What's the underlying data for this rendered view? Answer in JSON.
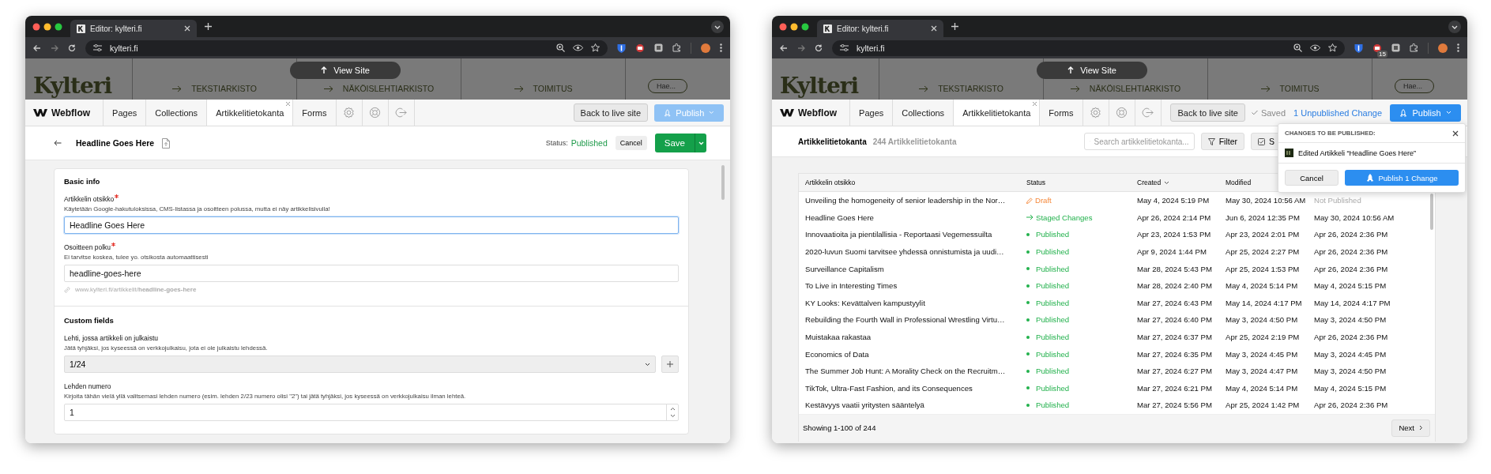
{
  "windows": [
    {
      "kind": "item_editor",
      "browser": {
        "tab_title": "Editor: kylteri.fi",
        "url": "kylteri.fi"
      },
      "site_header": {
        "logo": "Kylteri",
        "view_site": "View Site",
        "nav": [
          "TEKSTIARKISTO",
          "NÄKÖISLEHTIARKISTO",
          "TOIMITUS"
        ],
        "search_placeholder": "Hae..."
      },
      "toolbar": {
        "brand": "Webflow",
        "tabs": [
          {
            "label": "Pages",
            "selected": false
          },
          {
            "label": "Collections",
            "selected": false
          },
          {
            "label": "Artikkelitietokanta",
            "selected": true
          },
          {
            "label": "Forms",
            "selected": false
          }
        ],
        "back_button": "Back to live site",
        "publish": {
          "label": "Publish",
          "disabled": true
        }
      },
      "editor": {
        "title": "Headline Goes Here",
        "status_label": "Status:",
        "status": "Published",
        "cancel": "Cancel",
        "save": "Save",
        "sections": [
          {
            "title": "Basic info",
            "fields": [
              {
                "kind": "text",
                "label": "Artikkelin otsikko",
                "required": true,
                "help": "Käytetään Google-hakutuloksissa, CMS-listassa ja osoitteen polussa, mutta ei näy artikkelisivulla!",
                "value": "Headline Goes Here",
                "focused": true
              },
              {
                "kind": "text",
                "label": "Osoitteen polku",
                "required": true,
                "help": "Ei tarvitse koskea, tulee yo. otsikosta automaattisesti",
                "value": "headline-goes-here",
                "focused": false,
                "url_hint": "www.kylteri.fi/artikkelit/**headline-goes-here**"
              }
            ]
          },
          {
            "title": "Custom fields",
            "fields": [
              {
                "kind": "select",
                "label": "Lehti, jossa artikkeli on julkaistu",
                "help": "Jätä tyhjäksi, jos kyseessä on verkkojulkaisu, jota ei ole julkaistu lehdessä.",
                "value": "1/24"
              },
              {
                "kind": "number",
                "label": "Lehden numero",
                "help": "Kirjoita tähän vielä yllä valitsemasi lehden numero (esim. lehden 2/23 numero olisi \"2\") tai jätä tyhjäksi, jos kyseessä on verkkojulkaisu ilman lehteä.",
                "value": "1"
              }
            ]
          }
        ]
      }
    },
    {
      "kind": "collection",
      "browser": {
        "tab_title": "Editor: kylteri.fi",
        "url": "kylteri.fi",
        "extension_badge": "15"
      },
      "site_header": {
        "logo": "Kylteri",
        "view_site": "View Site",
        "nav": [
          "TEKSTIARKISTO",
          "NÄKÖISLEHTIARKISTO",
          "TOIMITUS"
        ],
        "search_placeholder": "Hae..."
      },
      "toolbar": {
        "brand": "Webflow",
        "tabs": [
          {
            "label": "Pages",
            "selected": false
          },
          {
            "label": "Collections",
            "selected": false
          },
          {
            "label": "Artikkelitietokanta",
            "selected": true
          },
          {
            "label": "Forms",
            "selected": false
          }
        ],
        "back_button": "Back to live site",
        "saved": "Saved",
        "unpublished": "1 Unpublished Change",
        "publish": {
          "label": "Publish",
          "disabled": false
        }
      },
      "collection": {
        "title": "Artikkelitietokanta",
        "count": "244 Artikkelitietokanta",
        "search_placeholder": "Search artikkelitietokanta...",
        "filter": "Filter",
        "partial_button": "S",
        "columns": [
          {
            "label": "Artikkelin otsikko",
            "sorted": false
          },
          {
            "label": "Status",
            "sorted": false
          },
          {
            "label": "Created",
            "sorted": true
          },
          {
            "label": "Modified",
            "sorted": false
          }
        ],
        "rows": [
          {
            "title": "Unveiling the homogeneity of senior leadership in the Nor…",
            "status": "Draft",
            "kind": "draft",
            "created": "May 4, 2024 5:19 PM",
            "modified": "May 30, 2024 10:56 AM",
            "published": "Not Published"
          },
          {
            "title": "Headline Goes Here",
            "status": "Staged Changes",
            "kind": "staged",
            "created": "Apr 26, 2024 2:14 PM",
            "modified": "Jun 6, 2024 12:35 PM",
            "published": "May 30, 2024 10:56 AM"
          },
          {
            "title": "Innovaatioita ja pientilallisia - Reportaasi Vegemessuilta",
            "status": "Published",
            "kind": "published",
            "created": "Apr 23, 2024 1:53 PM",
            "modified": "Apr 23, 2024 2:01 PM",
            "published": "Apr 26, 2024 2:36 PM"
          },
          {
            "title": "2020-luvun Suomi tarvitsee yhdessä onnistumista ja uudi…",
            "status": "Published",
            "kind": "published",
            "created": "Apr 9, 2024 1:44 PM",
            "modified": "Apr 25, 2024 2:27 PM",
            "published": "Apr 26, 2024 2:36 PM"
          },
          {
            "title": "Surveillance Capitalism",
            "status": "Published",
            "kind": "published",
            "created": "Mar 28, 2024 5:43 PM",
            "modified": "Apr 25, 2024 1:53 PM",
            "published": "Apr 26, 2024 2:36 PM"
          },
          {
            "title": "To Live in Interesting Times",
            "status": "Published",
            "kind": "published",
            "created": "Mar 28, 2024 2:40 PM",
            "modified": "May 4, 2024 5:14 PM",
            "published": "May 4, 2024 5:15 PM"
          },
          {
            "title": "KY Looks: Kevättalven kampustyylit",
            "status": "Published",
            "kind": "published",
            "created": "Mar 27, 2024 6:43 PM",
            "modified": "May 14, 2024 4:17 PM",
            "published": "May 14, 2024 4:17 PM"
          },
          {
            "title": "Rebuilding the Fourth Wall in Professional Wrestling Virtu…",
            "status": "Published",
            "kind": "published",
            "created": "Mar 27, 2024 6:40 PM",
            "modified": "May 3, 2024 4:50 PM",
            "published": "May 3, 2024 4:50 PM"
          },
          {
            "title": "Muistakaa rakastaa",
            "status": "Published",
            "kind": "published",
            "created": "Mar 27, 2024 6:37 PM",
            "modified": "Apr 25, 2024 2:19 PM",
            "published": "Apr 26, 2024 2:36 PM"
          },
          {
            "title": "Economics of Data",
            "status": "Published",
            "kind": "published",
            "created": "Mar 27, 2024 6:35 PM",
            "modified": "May 3, 2024 4:45 PM",
            "published": "May 3, 2024 4:45 PM"
          },
          {
            "title": "The Summer Job Hunt: A Morality Check on the Recruitm…",
            "status": "Published",
            "kind": "published",
            "created": "Mar 27, 2024 6:27 PM",
            "modified": "May 3, 2024 4:47 PM",
            "published": "May 3, 2024 4:50 PM"
          },
          {
            "title": "TikTok, Ultra-Fast Fashion, and its Consequences",
            "status": "Published",
            "kind": "published",
            "created": "Mar 27, 2024 6:21 PM",
            "modified": "May 4, 2024 5:14 PM",
            "published": "May 4, 2024 5:15 PM"
          },
          {
            "title": "Kestävyys vaatii yritysten sääntelyä",
            "status": "Published",
            "kind": "published",
            "created": "Mar 27, 2024 5:56 PM",
            "modified": "Apr 25, 2024 1:42 PM",
            "published": "Apr 26, 2024 2:36 PM"
          }
        ],
        "footer": "Showing 1-100 of 244",
        "next": "Next",
        "popover": {
          "heading": "CHANGES TO BE PUBLISHED:",
          "items": [
            "Edited Artikkeli “Headline Goes Here”"
          ],
          "cancel": "Cancel",
          "publish": "Publish 1 Change"
        }
      }
    }
  ]
}
